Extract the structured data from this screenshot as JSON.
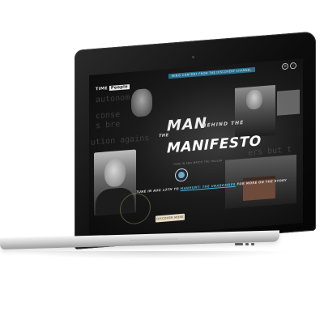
{
  "header": {
    "logo_time": "TIME",
    "logo_people": "People",
    "top_link": "MINIS CONTENT FROM THE DISCOVERY CHANNEL"
  },
  "hero": {
    "title_the": "THE",
    "title_man": "MAN",
    "title_behind": "BEHIND THE",
    "title_manifesto": "MANIFESTO",
    "small_caption": "TUNE IN AND WATCH THE TRAILER"
  },
  "tagline": {
    "prefix": "TUNE IN AUG 13TH TO",
    "highlight": "MANHUNT: THE UNABOMBER",
    "suffix": "FOR MORE ON THE STORY"
  },
  "cta": {
    "label": "DISCOVER MORE"
  },
  "background_text": {
    "line1": "autonom",
    "line2": "conse",
    "line3": "s bre",
    "line4": "ution agains",
    "line5": "ers but t"
  },
  "colors": {
    "accent": "#2b6e8f",
    "highlight": "#4fb0d8",
    "cta_bg": "#e7dcc2"
  },
  "icons": [
    "settings-icon",
    "info-icon",
    "play-icon"
  ]
}
